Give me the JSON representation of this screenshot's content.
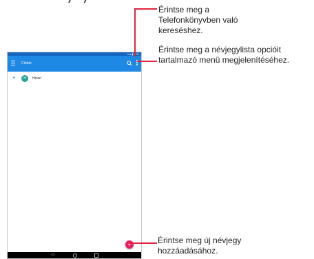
{
  "heading_fragment": "·/ ·/",
  "callouts": {
    "search": [
      "Érintse meg a",
      "Telefonkönyvben való",
      "kereséshez."
    ],
    "menu": [
      "Érintse meg a névjegylista opcióit",
      "tartalmazó menü megjelenítéséhez."
    ],
    "add": [
      "Érintse meg új névjegy",
      "hozzáadásához."
    ]
  },
  "tablet": {
    "status_text": "▾ ▴ ▮ 8:11",
    "app_title": "Címtár",
    "contact": {
      "initial": "H",
      "name": "Helen"
    },
    "fab_symbol": "+",
    "nav": {
      "back": "◁"
    }
  },
  "colors": {
    "appbar": "#1e88e5",
    "fab": "#e91e63",
    "leader_lines": "#e0223c"
  },
  "icons": [
    "menu-icon",
    "search-icon",
    "more-vert-icon",
    "star-icon",
    "add-icon",
    "back-icon",
    "home-icon",
    "recents-icon"
  ]
}
